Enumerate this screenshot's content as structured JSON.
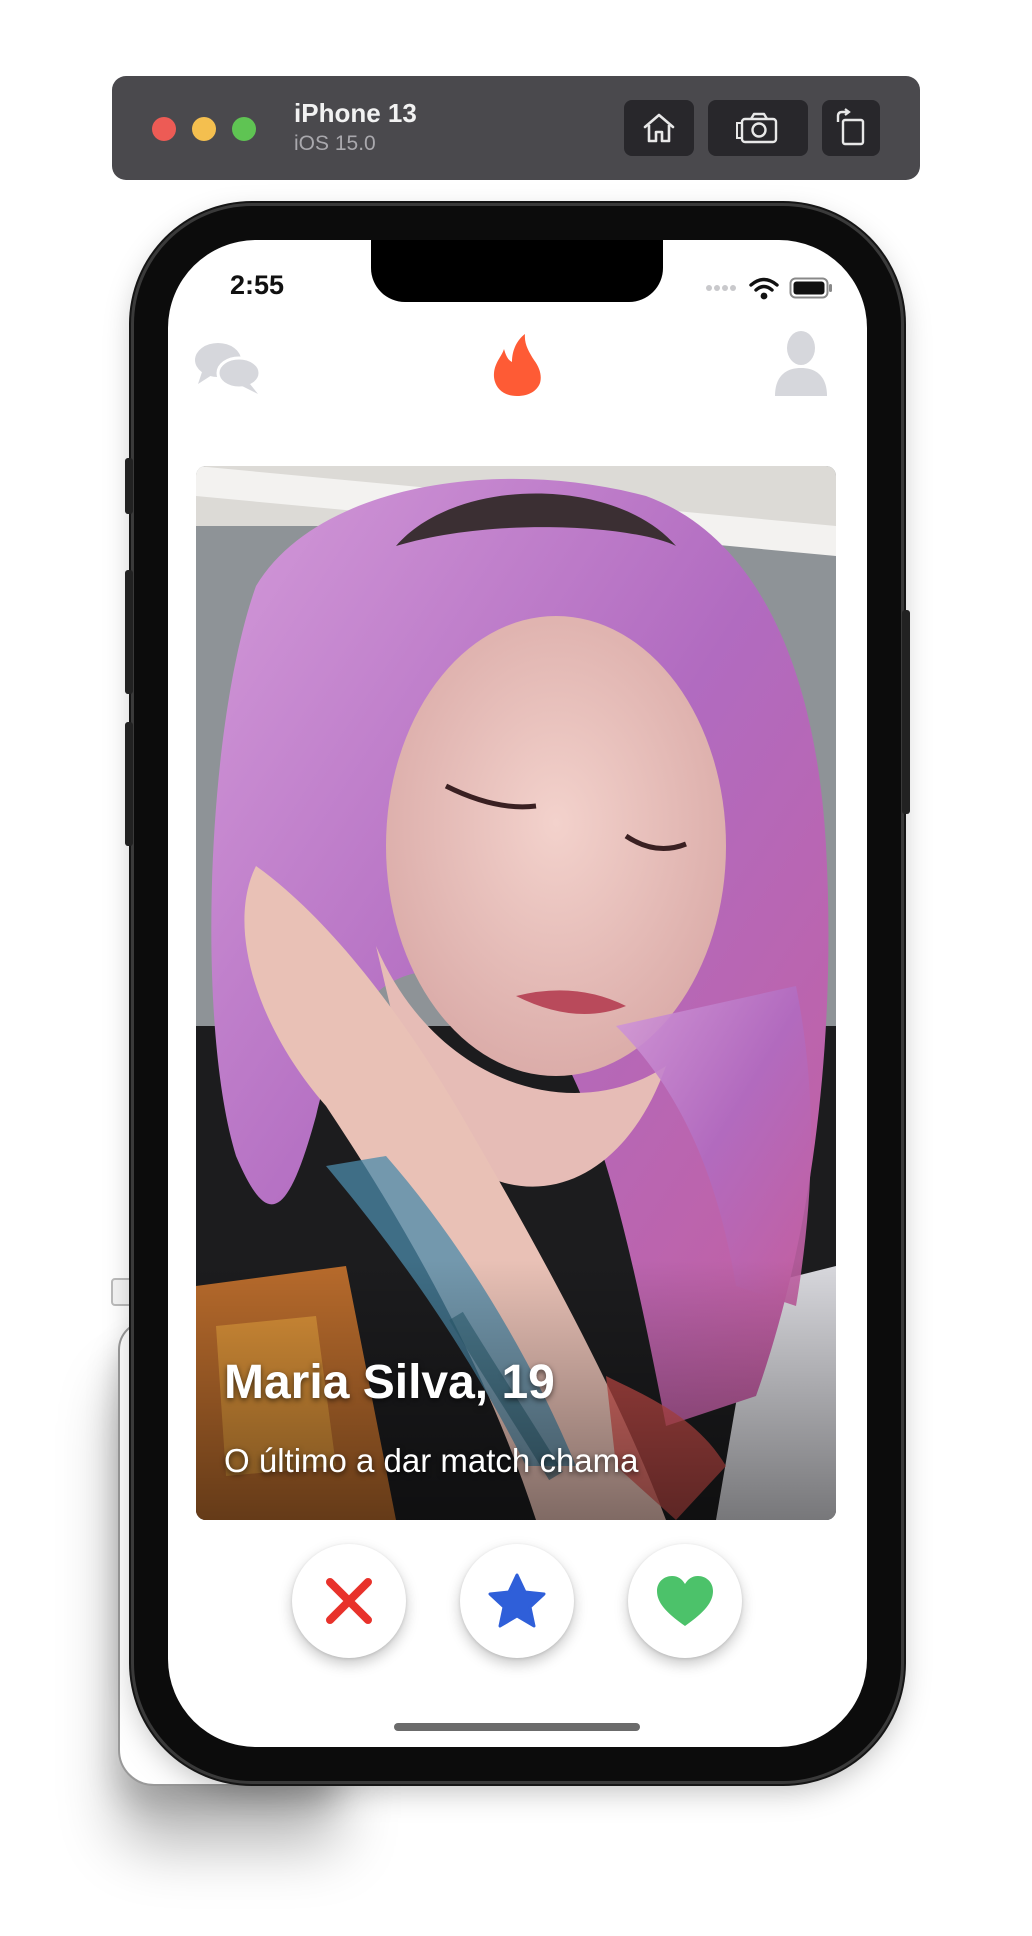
{
  "simulator": {
    "device_name": "iPhone 13",
    "os_version": "iOS 15.0",
    "buttons": [
      "home-icon",
      "screenshot-icon",
      "rotate-icon"
    ]
  },
  "status_bar": {
    "time": "2:55",
    "icons": [
      "signal-dots-icon",
      "wifi-icon",
      "battery-icon"
    ]
  },
  "top_bar": {
    "left_icon": "chat-icon",
    "center_icon": "flame-icon",
    "right_icon": "profile-icon",
    "brand_color": "#fe5b35",
    "inactive_icon_color": "#d6d7dc"
  },
  "card": {
    "name": "Maria Silva, 19",
    "bio": "O último a dar match chama"
  },
  "actions": {
    "nope": {
      "icon": "close-icon",
      "color": "#e8322b"
    },
    "super_like": {
      "icon": "star-icon",
      "color": "#2f5fd9"
    },
    "like": {
      "icon": "heart-icon",
      "color": "#4cc26a"
    }
  }
}
